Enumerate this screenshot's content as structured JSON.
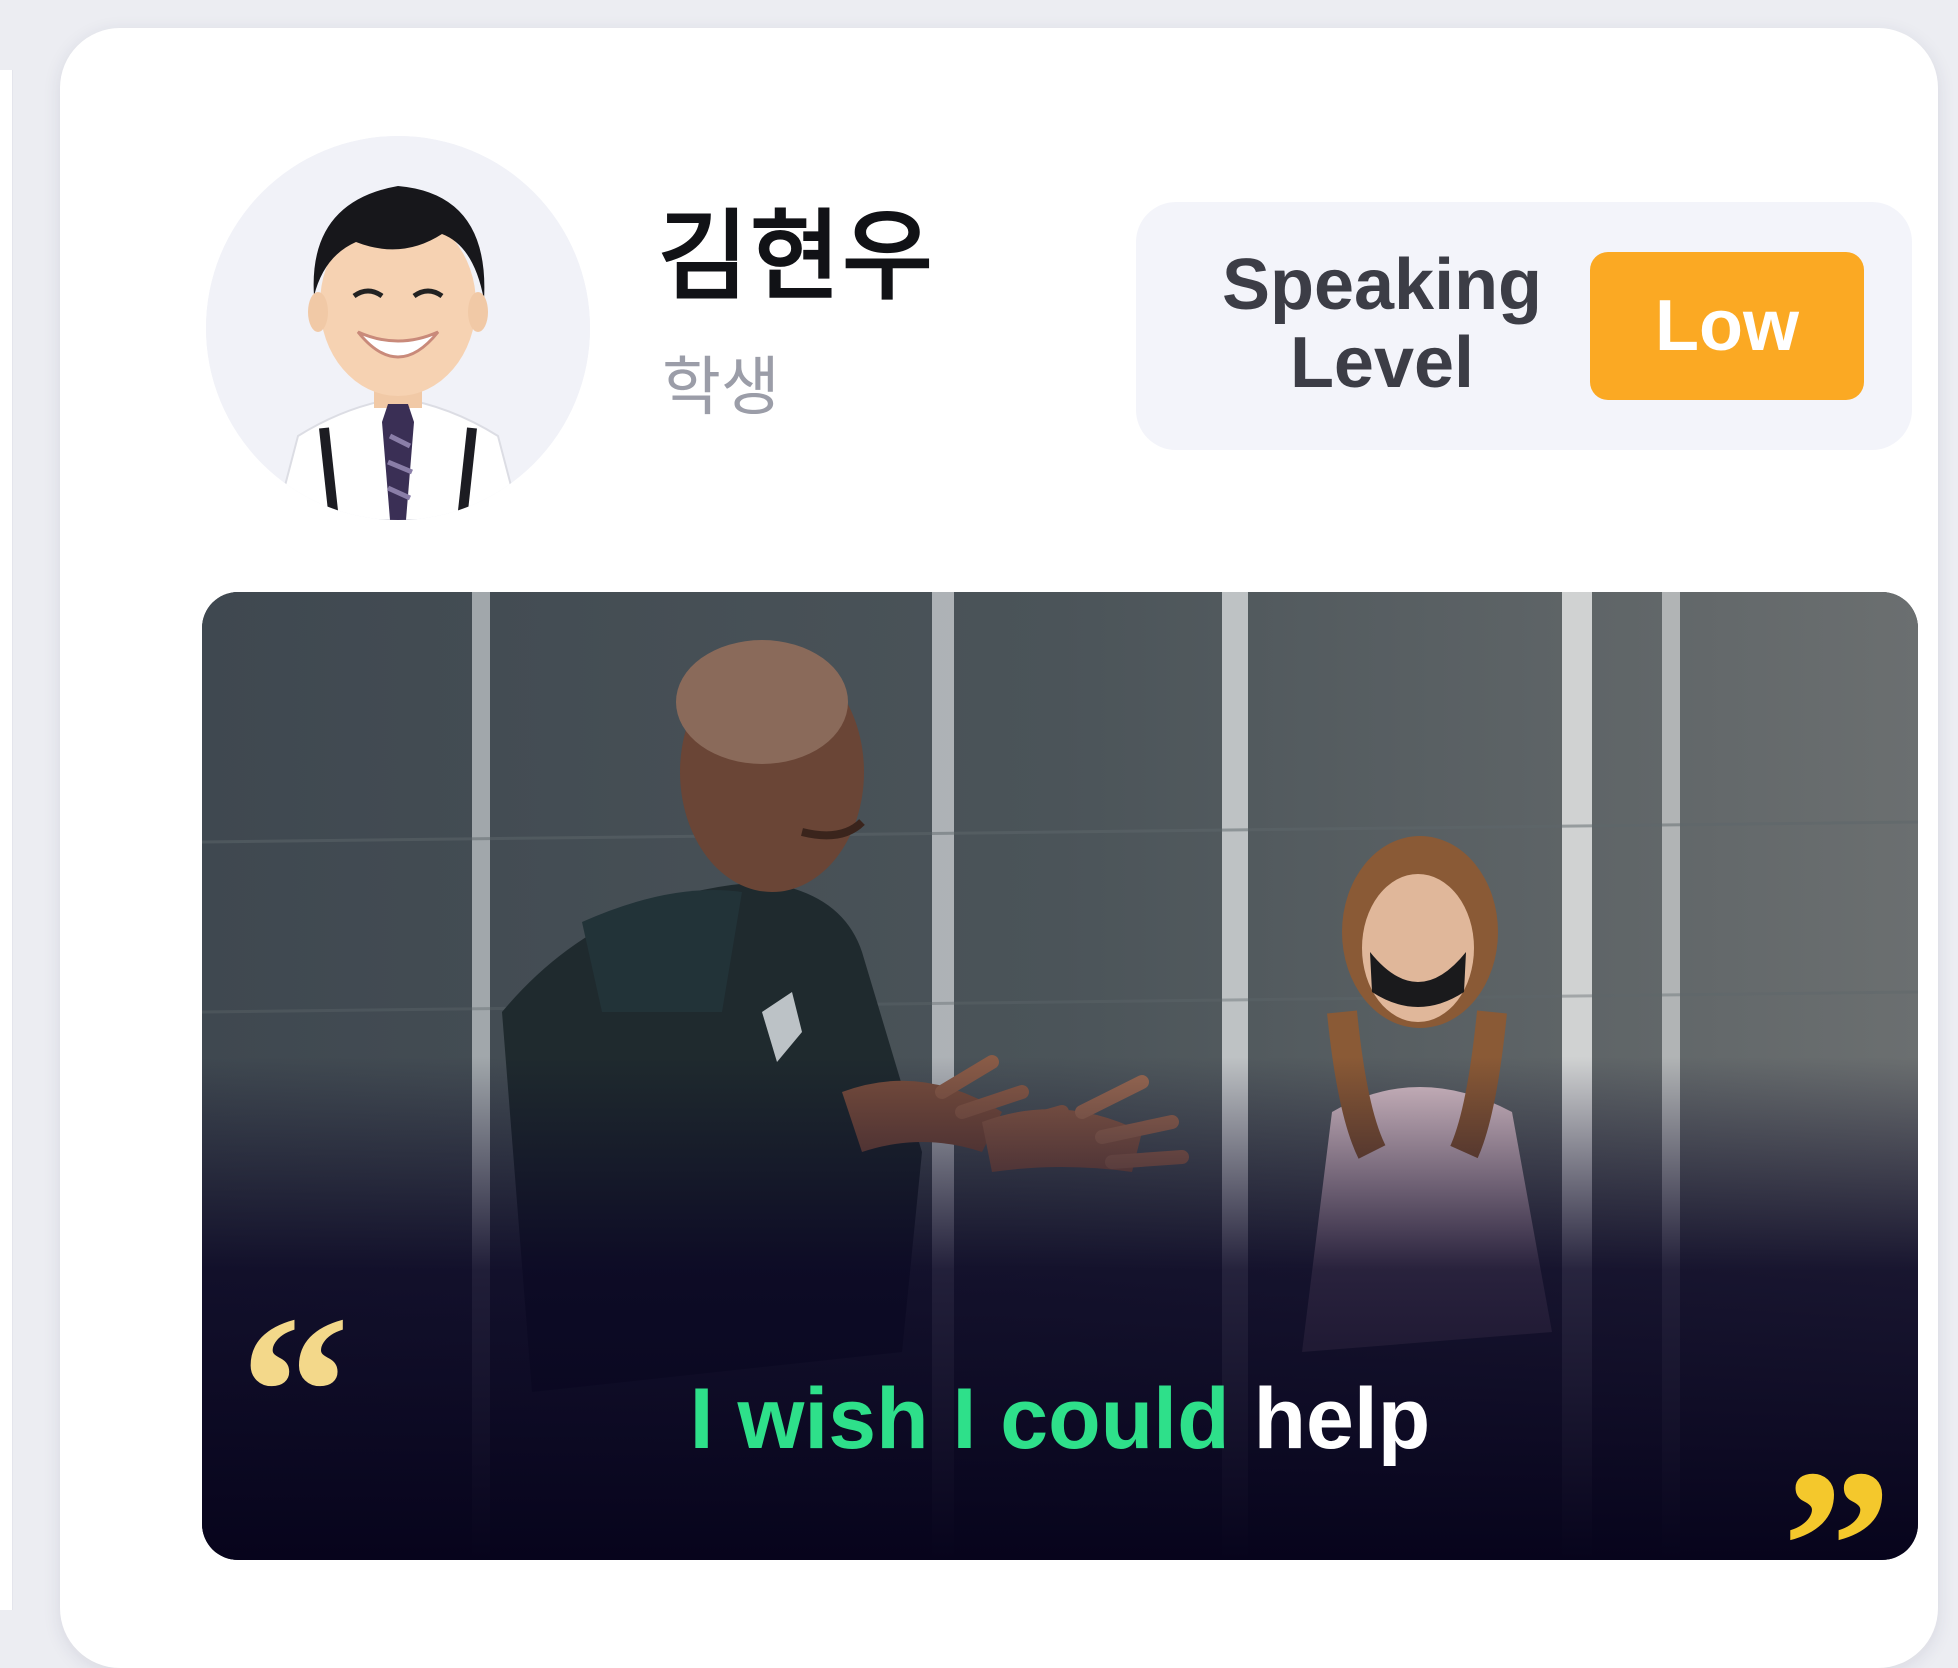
{
  "profile": {
    "name": "김현우",
    "role": "학생"
  },
  "speaking_level": {
    "label": "Speaking Level",
    "value": "Low",
    "badge_color": "#fba923"
  },
  "video": {
    "caption_spoken": "I wish I could",
    "caption_pending": "help",
    "spoken_color": "#2ee08a",
    "pending_color": "#ffffff",
    "quote_open_glyph": "“",
    "quote_close_glyph": "”"
  }
}
